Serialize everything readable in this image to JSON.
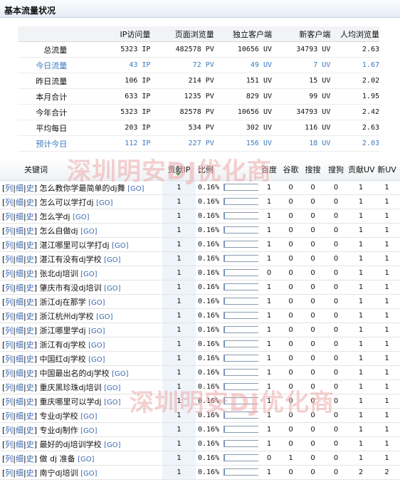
{
  "section_title": "基本流量状况",
  "watermark": "深圳明安DJ优化商",
  "summary": {
    "headers": [
      "IP访问量",
      "页面浏览量",
      "独立客户端",
      "新客户端",
      "人均浏览量"
    ],
    "rows": [
      {
        "label": "总流量",
        "ip": "5323 IP",
        "pv": "482578 PV",
        "uv": "10656 UV",
        "new_uv": "34793 UV",
        "avg": "2.63",
        "highlight": false
      },
      {
        "label": "今日流量",
        "ip": "43 IP",
        "pv": "72 PV",
        "uv": "49 UV",
        "new_uv": "7 UV",
        "avg": "1.67",
        "highlight": true
      },
      {
        "label": "昨日流量",
        "ip": "106 IP",
        "pv": "214 PV",
        "uv": "151 UV",
        "new_uv": "15 UV",
        "avg": "2.02",
        "highlight": false
      },
      {
        "label": "本月合计",
        "ip": "633 IP",
        "pv": "1235 PV",
        "uv": "829 UV",
        "new_uv": "99 UV",
        "avg": "1.95",
        "highlight": false
      },
      {
        "label": "今年合计",
        "ip": "5323 IP",
        "pv": "82578 PV",
        "uv": "10656 UV",
        "new_uv": "34793 UV",
        "avg": "2.42",
        "highlight": false
      },
      {
        "label": "平均每日",
        "ip": "203 IP",
        "pv": "534 PV",
        "uv": "302 UV",
        "new_uv": "116 UV",
        "avg": "2.63",
        "highlight": false
      },
      {
        "label": "预计今日",
        "ip": "112 IP",
        "pv": "227 PV",
        "uv": "156 UV",
        "new_uv": "18 UV",
        "avg": "2.03",
        "highlight": true
      }
    ]
  },
  "keywords": {
    "headers": {
      "keyword": "关键词",
      "contrib_ip": "贡献IP",
      "ratio": "比例",
      "baidu": "百度",
      "google": "谷歌",
      "sousou": "搜搜",
      "sogou": "搜狗",
      "contrib_uv": "贡献UV",
      "new_uv": "新UV"
    },
    "links": {
      "list": "列",
      "detail": "细",
      "history": "史",
      "go": "[GO]"
    },
    "rows": [
      {
        "kw": "怎么教你学最简单的dj舞",
        "ip": "1",
        "pct": "0.16%",
        "fill": 0.0016,
        "baidu": "1",
        "google": "0",
        "sousou": "0",
        "sogou": "0",
        "cuv": "1",
        "nuv": "1"
      },
      {
        "kw": "怎么可以学打dj",
        "ip": "1",
        "pct": "0.16%",
        "fill": 0.0016,
        "baidu": "1",
        "google": "0",
        "sousou": "0",
        "sogou": "0",
        "cuv": "1",
        "nuv": "1"
      },
      {
        "kw": "怎么学dj",
        "ip": "1",
        "pct": "0.16%",
        "fill": 0.0016,
        "baidu": "1",
        "google": "0",
        "sousou": "0",
        "sogou": "0",
        "cuv": "1",
        "nuv": "1"
      },
      {
        "kw": "怎么自做dj",
        "ip": "1",
        "pct": "0.16%",
        "fill": 0.0016,
        "baidu": "1",
        "google": "0",
        "sousou": "0",
        "sogou": "0",
        "cuv": "1",
        "nuv": "1"
      },
      {
        "kw": "湛江哪里可以学打dj",
        "ip": "1",
        "pct": "0.16%",
        "fill": 0.0016,
        "baidu": "1",
        "google": "0",
        "sousou": "0",
        "sogou": "0",
        "cuv": "1",
        "nuv": "1"
      },
      {
        "kw": "湛江有没有dj学校",
        "ip": "1",
        "pct": "0.16%",
        "fill": 0.0016,
        "baidu": "1",
        "google": "0",
        "sousou": "0",
        "sogou": "0",
        "cuv": "1",
        "nuv": "1"
      },
      {
        "kw": "张北dj培训",
        "ip": "1",
        "pct": "0.16%",
        "fill": 0.0016,
        "baidu": "0",
        "google": "0",
        "sousou": "0",
        "sogou": "0",
        "cuv": "1",
        "nuv": "1"
      },
      {
        "kw": "肇庆市有没dj培训",
        "ip": "1",
        "pct": "0.16%",
        "fill": 0.0016,
        "baidu": "1",
        "google": "0",
        "sousou": "0",
        "sogou": "0",
        "cuv": "1",
        "nuv": "1"
      },
      {
        "kw": "浙江dj在那学",
        "ip": "1",
        "pct": "0.16%",
        "fill": 0.0016,
        "baidu": "1",
        "google": "0",
        "sousou": "0",
        "sogou": "0",
        "cuv": "1",
        "nuv": "1"
      },
      {
        "kw": "浙江杭州dj学校",
        "ip": "1",
        "pct": "0.16%",
        "fill": 0.0016,
        "baidu": "1",
        "google": "0",
        "sousou": "0",
        "sogou": "0",
        "cuv": "1",
        "nuv": "1"
      },
      {
        "kw": "浙江哪里学dj",
        "ip": "1",
        "pct": "0.16%",
        "fill": 0.0016,
        "baidu": "1",
        "google": "0",
        "sousou": "0",
        "sogou": "0",
        "cuv": "1",
        "nuv": "1"
      },
      {
        "kw": "浙江有dj学校",
        "ip": "1",
        "pct": "0.16%",
        "fill": 0.0016,
        "baidu": "1",
        "google": "0",
        "sousou": "0",
        "sogou": "0",
        "cuv": "1",
        "nuv": "1"
      },
      {
        "kw": "中国红dj学校",
        "ip": "1",
        "pct": "0.16%",
        "fill": 0.0016,
        "baidu": "1",
        "google": "0",
        "sousou": "0",
        "sogou": "0",
        "cuv": "1",
        "nuv": "1"
      },
      {
        "kw": "中国最出名的dj学校",
        "ip": "1",
        "pct": "0.16%",
        "fill": 0.0016,
        "baidu": "1",
        "google": "0",
        "sousou": "0",
        "sogou": "0",
        "cuv": "1",
        "nuv": "1"
      },
      {
        "kw": "重庆黑珍珠dj培训",
        "ip": "1",
        "pct": "0.16%",
        "fill": 0.0016,
        "baidu": "1",
        "google": "0",
        "sousou": "0",
        "sogou": "0",
        "cuv": "1",
        "nuv": "1"
      },
      {
        "kw": "重庆哪里可以学dj",
        "ip": "1",
        "pct": "0.16%",
        "fill": 0.0016,
        "baidu": "1",
        "google": "0",
        "sousou": "0",
        "sogou": "0",
        "cuv": "1",
        "nuv": "1"
      },
      {
        "kw": "专业dj学校",
        "ip": "1",
        "pct": "0.16%",
        "fill": 0.0016,
        "baidu": "1",
        "google": "0",
        "sousou": "0",
        "sogou": "0",
        "cuv": "1",
        "nuv": "1"
      },
      {
        "kw": "专业dj制作",
        "ip": "1",
        "pct": "0.16%",
        "fill": 0.0016,
        "baidu": "1",
        "google": "0",
        "sousou": "0",
        "sogou": "0",
        "cuv": "1",
        "nuv": "1"
      },
      {
        "kw": "最好的dj培训学校",
        "ip": "1",
        "pct": "0.16%",
        "fill": 0.0016,
        "baidu": "1",
        "google": "0",
        "sousou": "0",
        "sogou": "0",
        "cuv": "1",
        "nuv": "1"
      },
      {
        "kw": "做 dj 准备",
        "ip": "1",
        "pct": "0.16%",
        "fill": 0.0016,
        "baidu": "0",
        "google": "1",
        "sousou": "0",
        "sogou": "0",
        "cuv": "1",
        "nuv": "1"
      },
      {
        "kw": "南宁dj培训",
        "ip": "1",
        "pct": "0.16%",
        "fill": 0.0016,
        "baidu": "1",
        "google": "0",
        "sousou": "0",
        "sogou": "0",
        "cuv": "2",
        "nuv": "2"
      }
    ]
  },
  "colors": {
    "link": "#3a68b0",
    "highlight_row_text": "#3a7ac0",
    "bar_fill": "#6a8fc4",
    "sort_marker": "#4a9a3a",
    "watermark": "#ecaaaa"
  }
}
